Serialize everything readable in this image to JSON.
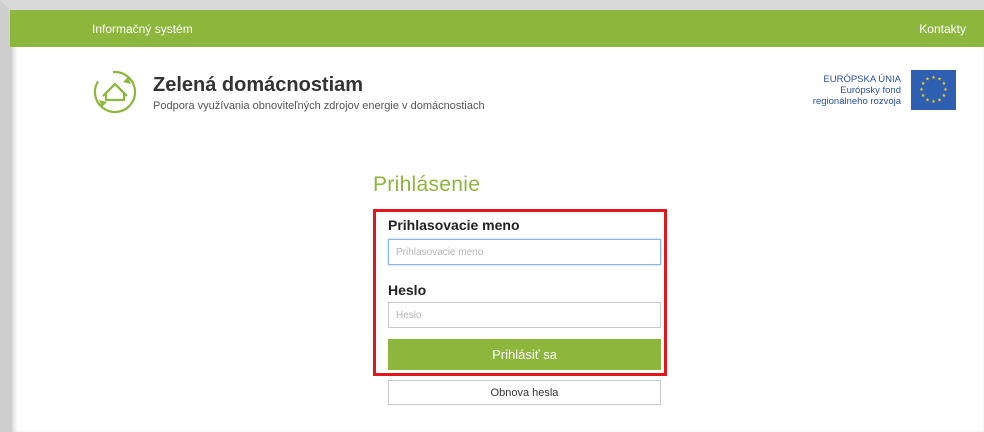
{
  "topbar": {
    "left_label": "Informačný systém",
    "right_label": "Kontakty"
  },
  "brand": {
    "title": "Zelená domácnostiam",
    "subtitle": "Podpora využívania obnoviteľných zdrojov energie v domácnostiach",
    "logo_icon": "house-recycle-icon"
  },
  "eu": {
    "line1": "EURÓPSKA ÚNIA",
    "line2": "Európsky fond",
    "line3": "regionálneho rozvoja",
    "flag_icon": "eu-flag-icon"
  },
  "login": {
    "heading": "Prihlásenie",
    "username_label": "Prihlasovacie meno",
    "username_placeholder": "Prihlasovacie meno",
    "username_value": "",
    "password_label": "Heslo",
    "password_placeholder": "Heslo",
    "password_value": "",
    "submit_label": "Prihlásiť sa",
    "reset_label": "Obnova hesla"
  },
  "colors": {
    "accent_green": "#8cb63c",
    "highlight_red": "#e0161c",
    "eu_blue": "#2f5fb3"
  }
}
